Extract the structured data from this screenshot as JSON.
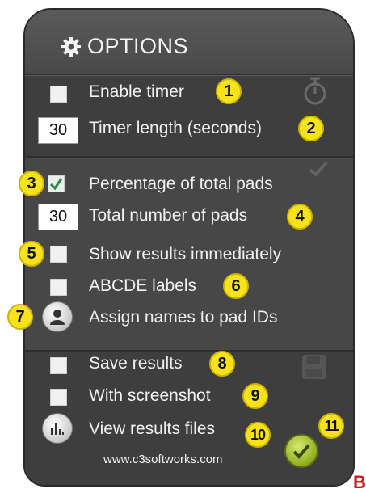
{
  "panel": {
    "title": "OPTIONS",
    "icons": {
      "title": "gear-icon",
      "timer_ghost": "stopwatch-icon",
      "check_ghost": "checkmark-icon",
      "save_ghost": "floppy-disk-icon"
    }
  },
  "timer": {
    "enable_label": "Enable timer",
    "enable_checked": false,
    "length_value": "30",
    "length_label": "Timer length (seconds)"
  },
  "pads": {
    "percentage_label": "Percentage of total pads",
    "percentage_checked": true,
    "total_value": "30",
    "total_label": "Total number of pads"
  },
  "display": {
    "show_results_label": "Show results immediately",
    "show_results_checked": false,
    "abcde_label": "ABCDE labels",
    "abcde_checked": false,
    "assign_names_label": "Assign names to pad IDs",
    "assign_icon": "user-icon"
  },
  "results": {
    "save_label": "Save results",
    "save_checked": false,
    "screenshot_label": "With screenshot",
    "screenshot_checked": false,
    "view_files_label": "View results files",
    "view_icon": "bar-chart-icon"
  },
  "footer": {
    "url": "www.c3softworks.com",
    "ok_icon": "checkmark-icon"
  },
  "callouts": [
    "1",
    "2",
    "3",
    "4",
    "5",
    "6",
    "7",
    "8",
    "9",
    "10",
    "11"
  ],
  "corner_letter": "B",
  "colors": {
    "callout": "#f7e21b",
    "panel": "#474747",
    "ok_button": "#8fae1c",
    "corner_letter": "#cc1a1a"
  }
}
